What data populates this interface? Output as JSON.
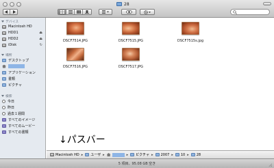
{
  "window": {
    "title": "28"
  },
  "toolbar": {
    "back_icon": "left-triangle-icon",
    "forward_icon": "right-triangle-icon",
    "view_modes": [
      "icon",
      "list",
      "column",
      "coverflow"
    ],
    "active_view": "icon",
    "action_icon": "list-menu-icon",
    "quicklook_icon": "eye-icon",
    "gear_icon": "gear-icon"
  },
  "sidebar": {
    "devices_header": "デバイス",
    "devices": [
      {
        "label": "Macintosh HD",
        "icon": "disk-icon",
        "eject": false
      },
      {
        "label": "HDD1",
        "icon": "disk-icon",
        "eject": true
      },
      {
        "label": "HDD2",
        "icon": "disk-icon",
        "eject": true
      },
      {
        "label": "iDisk",
        "icon": "disk-icon",
        "eject": false
      }
    ],
    "places_header": "場所",
    "places": [
      {
        "label": "デスクトップ",
        "icon": "folder-icon"
      },
      {
        "label": "",
        "icon": "home-icon",
        "selected": true
      },
      {
        "label": "アプリケーション",
        "icon": "folder-icon"
      },
      {
        "label": "書類",
        "icon": "folder-icon"
      },
      {
        "label": "ピクチャ",
        "icon": "folder-icon"
      }
    ],
    "search_header": "検索",
    "searches": [
      {
        "label": "今日",
        "icon": "clock-icon"
      },
      {
        "label": "昨日",
        "icon": "clock-icon"
      },
      {
        "label": "過去１週間",
        "icon": "clock-icon"
      },
      {
        "label": "すべてのイメージ",
        "icon": "smart-folder-icon"
      },
      {
        "label": "すべてのムービー",
        "icon": "smart-folder-icon"
      },
      {
        "label": "すべての書類",
        "icon": "smart-folder-icon"
      }
    ]
  },
  "files": [
    {
      "name": "DSCF7514.JPG"
    },
    {
      "name": "DSCF7515.JPG"
    },
    {
      "name": "DSCF7515s.jpg"
    },
    {
      "name": "DSCF7516.JPG"
    },
    {
      "name": "DSCF7517.JPG"
    }
  ],
  "annotation": "↓パスバー",
  "pathbar": {
    "items": [
      {
        "label": "Macintosh HD",
        "icon": "disk-icon"
      },
      {
        "label": "ユーザ",
        "icon": "folder-icon"
      },
      {
        "label": "",
        "icon": "home-icon",
        "selected": true
      },
      {
        "label": "ピクチャ",
        "icon": "folder-icon"
      },
      {
        "label": "2007",
        "icon": "folder-icon"
      },
      {
        "label": "10",
        "icon": "folder-icon"
      },
      {
        "label": "28",
        "icon": "folder-icon"
      }
    ]
  },
  "status": {
    "text": "5 項目、95.08 GB 空き"
  }
}
